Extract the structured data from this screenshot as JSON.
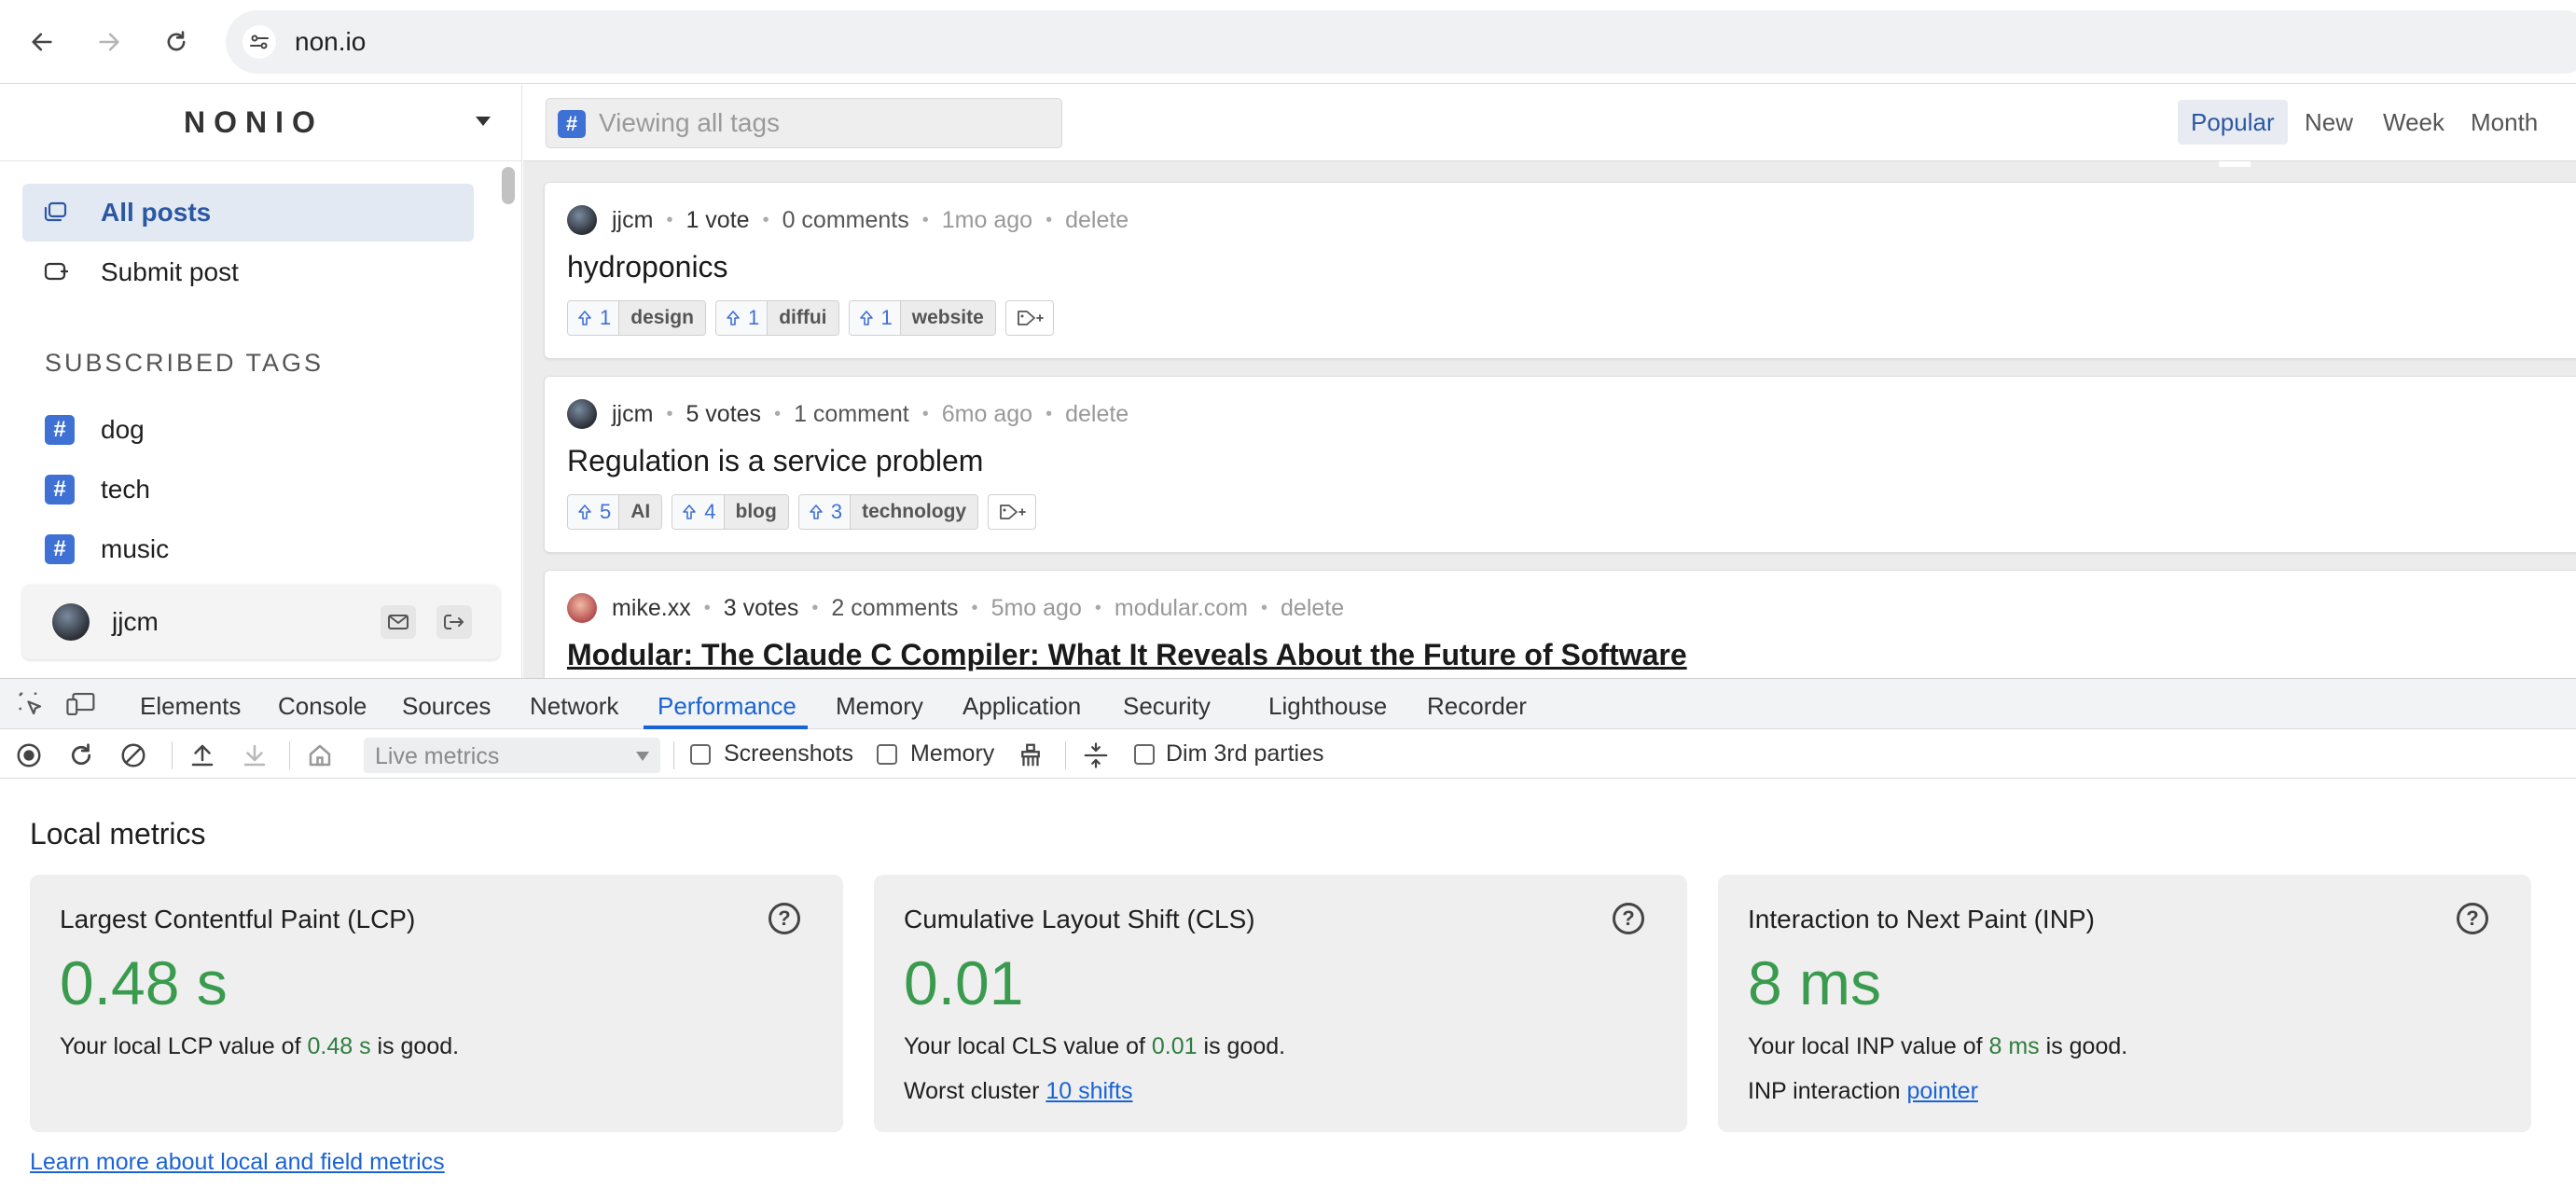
{
  "browser": {
    "url": "non.io"
  },
  "sidebar": {
    "brand": "NONIO",
    "nav": [
      {
        "label": "All posts",
        "icon": "posts-icon",
        "active": true
      },
      {
        "label": "Submit post",
        "icon": "submit-icon",
        "active": false
      }
    ],
    "subscribed_title": "SUBSCRIBED TAGS",
    "tags": [
      "dog",
      "tech",
      "music"
    ],
    "tag_hash": "#",
    "user": {
      "name": "jjcm"
    }
  },
  "feed": {
    "search_placeholder": "Viewing all tags",
    "search_hash": "#",
    "sort_tabs": [
      "Popular",
      "New",
      "Week",
      "Month"
    ],
    "active_sort": "Popular",
    "posts": [
      {
        "author": "jjcm",
        "votes": "1 vote",
        "comments": "0 comments",
        "age": "1mo ago",
        "domain": "",
        "delete": "delete",
        "title": "hydroponics",
        "tags": [
          {
            "count": "1",
            "name": "design"
          },
          {
            "count": "1",
            "name": "diffui"
          },
          {
            "count": "1",
            "name": "website"
          }
        ]
      },
      {
        "author": "jjcm",
        "votes": "5 votes",
        "comments": "1 comment",
        "age": "6mo ago",
        "domain": "",
        "delete": "delete",
        "title": "Regulation is a service problem",
        "tags": [
          {
            "count": "5",
            "name": "AI"
          },
          {
            "count": "4",
            "name": "blog"
          },
          {
            "count": "3",
            "name": "technology"
          }
        ]
      },
      {
        "author": "mike.xx",
        "votes": "3 votes",
        "comments": "2 comments",
        "age": "5mo ago",
        "domain": "modular.com",
        "delete": "delete",
        "title": "Modular: The Claude C Compiler: What It Reveals About the Future of Software",
        "tags": []
      }
    ]
  },
  "devtools": {
    "tabs": [
      "Elements",
      "Console",
      "Sources",
      "Network",
      "Performance",
      "Memory",
      "Application",
      "Security",
      "Lighthouse",
      "Recorder"
    ],
    "active_tab": "Performance",
    "toolbar": {
      "live_select": "Live metrics",
      "screenshots": "Screenshots",
      "memory": "Memory",
      "dim": "Dim 3rd parties"
    },
    "local_title": "Local metrics",
    "metrics": [
      {
        "name": "Largest Contentful Paint (LCP)",
        "value": "0.48 s",
        "desc_pre": "Your local LCP value of ",
        "desc_val": "0.48 s",
        "desc_post": " is good.",
        "extra_label": "",
        "extra_link": ""
      },
      {
        "name": "Cumulative Layout Shift (CLS)",
        "value": "0.01",
        "desc_pre": "Your local CLS value of ",
        "desc_val": "0.01",
        "desc_post": " is good.",
        "extra_label": "Worst cluster ",
        "extra_link": "10 shifts"
      },
      {
        "name": "Interaction to Next Paint (INP)",
        "value": "8 ms",
        "desc_pre": "Your local INP value of ",
        "desc_val": "8 ms",
        "desc_post": " is good.",
        "extra_label": "INP interaction ",
        "extra_link": "pointer"
      }
    ],
    "help_glyph": "?",
    "learn_more": "Learn more about local and field metrics"
  },
  "colors": {
    "accent": "#2b57a3",
    "tag_hash": "#3f70d4",
    "good": "#3a9b4f",
    "devtools_blue": "#1a63d6"
  }
}
